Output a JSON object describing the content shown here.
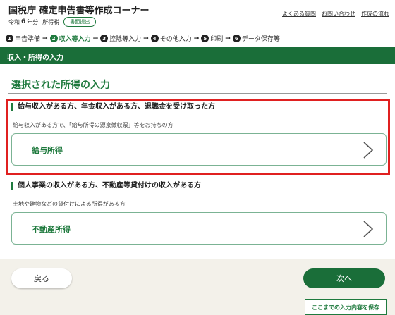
{
  "header": {
    "title": "国税庁 確定申告書等作成コーナー",
    "era": "令和",
    "year": "6",
    "year_suffix": "年分",
    "tax_type": "所得税",
    "doc_badge": "書面提出",
    "links": [
      "よくある質問",
      "お問い合わせ",
      "作成の流れ"
    ]
  },
  "steps": [
    {
      "num": "1",
      "label": "申告準備"
    },
    {
      "num": "2",
      "label": "収入等入力"
    },
    {
      "num": "3",
      "label": "控除等入力"
    },
    {
      "num": "4",
      "label": "その他入力"
    },
    {
      "num": "5",
      "label": "印刷"
    },
    {
      "num": "6",
      "label": "データ保存等"
    }
  ],
  "active_step": 2,
  "page_bar": "収入・所得の入力",
  "section_title": "選択された所得の入力",
  "groups": [
    {
      "heading": "給与収入がある方、年金収入がある方、退職金を受け取った方",
      "description": "給与収入がある方で、「給与所得の源泉徴収票」等をお持ちの方",
      "card": {
        "label": "給与所得",
        "value": "–"
      }
    },
    {
      "heading": "個人事業の収入がある方、不動産等貸付けの収入がある方",
      "description": "土地や建物などの貸付けによる所得がある方",
      "card": {
        "label": "不動産所得",
        "value": "–"
      }
    }
  ],
  "footer": {
    "back": "戻る",
    "next": "次へ",
    "save": "ここまでの入力内容を保存"
  },
  "colors": {
    "brand_green": "#1a6e39",
    "highlight_red": "#e02020"
  }
}
